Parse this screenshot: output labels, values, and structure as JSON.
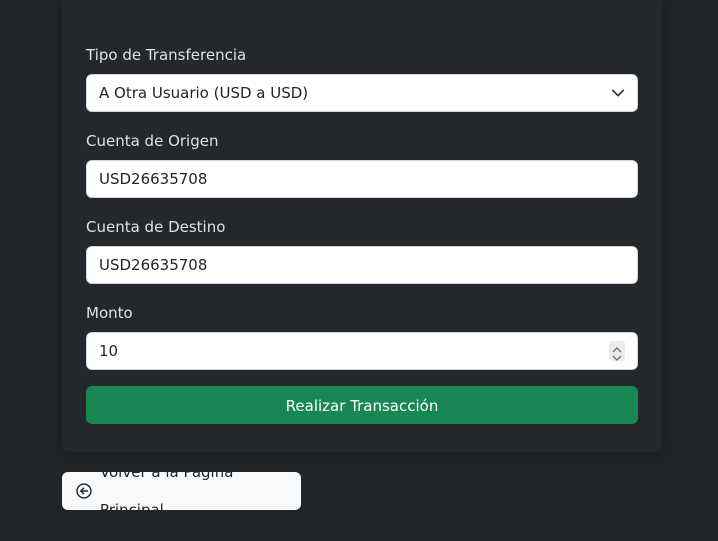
{
  "form": {
    "transfer_type": {
      "label": "Tipo de Transferencia",
      "selected": "A Otra Usuario (USD a USD)"
    },
    "origin_account": {
      "label": "Cuenta de Origen",
      "value": "USD26635708"
    },
    "destination_account": {
      "label": "Cuenta de Destino",
      "value": "USD26635708"
    },
    "amount": {
      "label": "Monto",
      "value": "10"
    },
    "submit_label": "Realizar Transacción"
  },
  "back_button": {
    "label": "Volver a la Página Principal",
    "icon": "arrow-left-circle-icon"
  },
  "colors": {
    "background": "#212529",
    "card": "#24282d",
    "primary_button": "#198754",
    "label_text": "#dee2e6"
  }
}
